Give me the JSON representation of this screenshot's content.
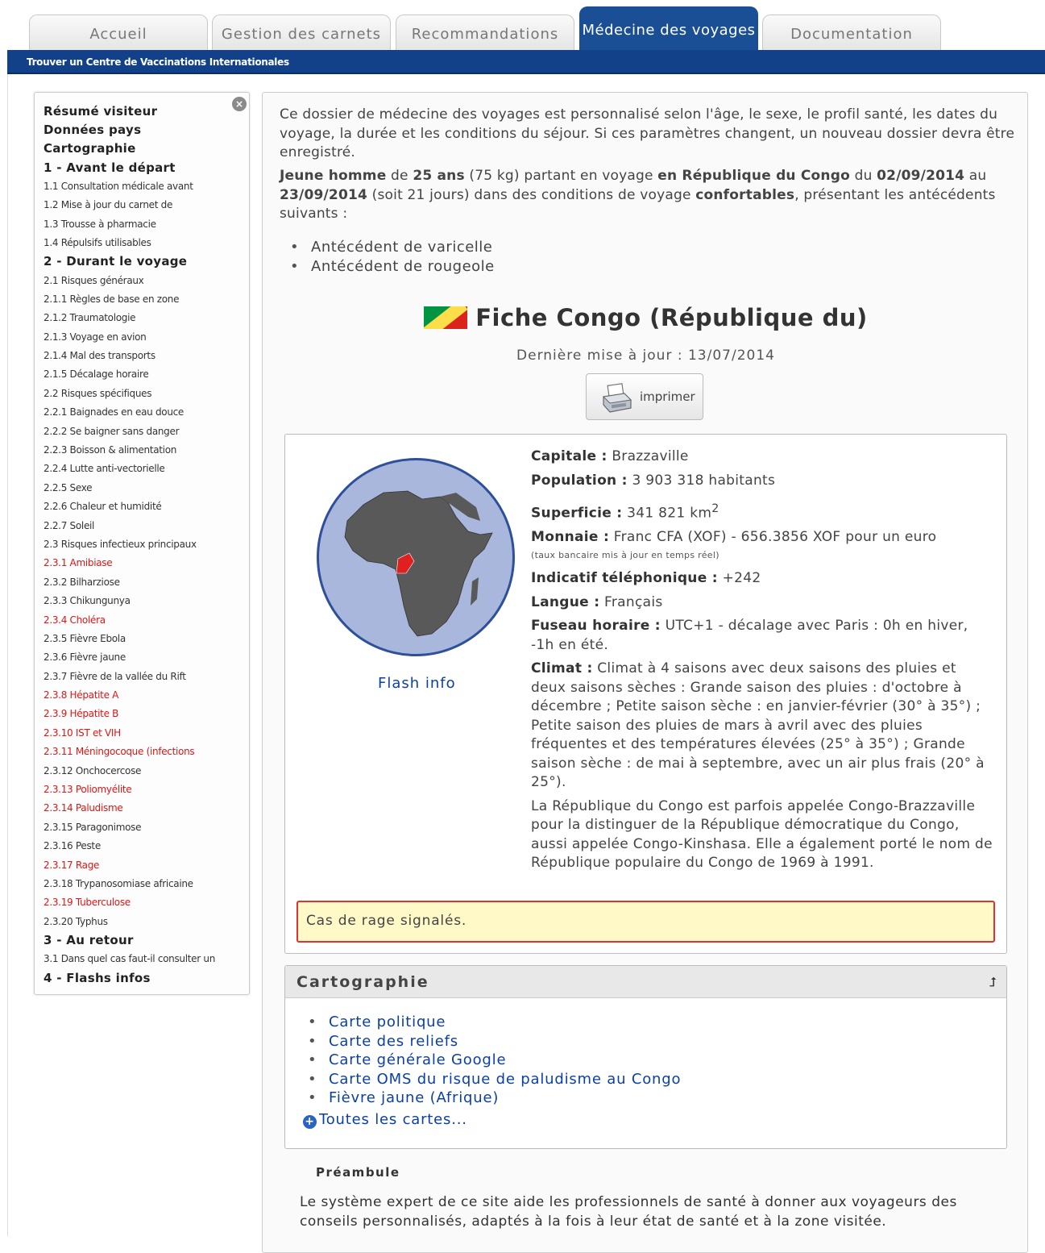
{
  "tabs": [
    {
      "label": "Accueil"
    },
    {
      "label": "Gestion des carnets"
    },
    {
      "label": "Recommandations"
    },
    {
      "label": "Médecine des voyages"
    },
    {
      "label": "Documentation"
    }
  ],
  "bluebar": {
    "link": "Trouver un Centre de Vaccinations Internationales"
  },
  "sidebar": {
    "close_icon": "×",
    "items": [
      {
        "label": "Résumé visiteur",
        "type": "h"
      },
      {
        "label": "Données pays",
        "type": "h"
      },
      {
        "label": "Cartographie",
        "type": "h"
      },
      {
        "label": "1 - Avant le départ",
        "type": "h"
      },
      {
        "label": "1.1 Consultation médicale avant",
        "type": "s"
      },
      {
        "label": "1.2 Mise à jour du carnet de",
        "type": "s"
      },
      {
        "label": "1.3 Trousse à pharmacie",
        "type": "s"
      },
      {
        "label": "1.4 Répulsifs utilisables",
        "type": "s"
      },
      {
        "label": "2 - Durant le voyage",
        "type": "h"
      },
      {
        "label": "2.1 Risques généraux",
        "type": "s"
      },
      {
        "label": "2.1.1 Règles de base en zone",
        "type": "s"
      },
      {
        "label": "2.1.2 Traumatologie",
        "type": "s"
      },
      {
        "label": "2.1.3 Voyage en avion",
        "type": "s"
      },
      {
        "label": "2.1.4 Mal des transports",
        "type": "s"
      },
      {
        "label": "2.1.5 Décalage horaire",
        "type": "s"
      },
      {
        "label": "2.2 Risques spécifiques",
        "type": "s"
      },
      {
        "label": "2.2.1 Baignades en eau douce",
        "type": "s"
      },
      {
        "label": "2.2.2 Se baigner sans danger",
        "type": "s"
      },
      {
        "label": "2.2.3 Boisson & alimentation",
        "type": "s"
      },
      {
        "label": "2.2.4 Lutte anti-vectorielle",
        "type": "s"
      },
      {
        "label": "2.2.5 Sexe",
        "type": "s"
      },
      {
        "label": "2.2.6 Chaleur et humidité",
        "type": "s"
      },
      {
        "label": "2.2.7 Soleil",
        "type": "s"
      },
      {
        "label": "2.3 Risques infectieux principaux",
        "type": "s"
      },
      {
        "label": "2.3.1 Amibiase",
        "type": "s red"
      },
      {
        "label": "2.3.2 Bilharziose",
        "type": "s"
      },
      {
        "label": "2.3.3 Chikungunya",
        "type": "s"
      },
      {
        "label": "2.3.4 Choléra",
        "type": "s red"
      },
      {
        "label": "2.3.5 Fièvre Ebola",
        "type": "s"
      },
      {
        "label": "2.3.6 Fièvre jaune",
        "type": "s"
      },
      {
        "label": "2.3.7 Fièvre de la vallée du Rift",
        "type": "s"
      },
      {
        "label": "2.3.8 Hépatite A",
        "type": "s red"
      },
      {
        "label": "2.3.9 Hépatite B",
        "type": "s red"
      },
      {
        "label": "2.3.10 IST et VIH",
        "type": "s red"
      },
      {
        "label": "2.3.11 Méningocoque (infections",
        "type": "s red"
      },
      {
        "label": "2.3.12 Onchocercose",
        "type": "s"
      },
      {
        "label": "2.3.13 Poliomyélite",
        "type": "s red"
      },
      {
        "label": "2.3.14 Paludisme",
        "type": "s red"
      },
      {
        "label": "2.3.15 Paragonimose",
        "type": "s"
      },
      {
        "label": "2.3.16 Peste",
        "type": "s"
      },
      {
        "label": "2.3.17 Rage",
        "type": "s red"
      },
      {
        "label": "2.3.18 Trypanosomiase africaine",
        "type": "s"
      },
      {
        "label": "2.3.19 Tuberculose",
        "type": "s red"
      },
      {
        "label": "2.3.20 Typhus",
        "type": "s"
      },
      {
        "label": "3 - Au retour",
        "type": "h"
      },
      {
        "label": "3.1 Dans quel cas faut-il consulter un",
        "type": "s"
      },
      {
        "label": "4 - Flashs infos",
        "type": "h"
      }
    ]
  },
  "intro": {
    "text": "Ce dossier de médecine des voyages est personnalisé selon l'âge, le sexe, le profil santé, les dates du voyage, la durée et les conditions du séjour. Si ces paramètres changent, un nouveau dossier devra être enregistré.",
    "profile": "Jeune homme",
    "de": " de ",
    "age": "25 ans",
    "weight": " (75 kg) partant en voyage ",
    "country": "en République du Congo",
    "du": " du ",
    "date_from": "02/09/2014",
    "au": " au ",
    "date_to": "23/09/2014",
    "duration": " (soit 21 jours) dans des conditions de voyage ",
    "conditions": "confortables",
    "tail": ", présentant les antécédents suivants :"
  },
  "antecedents": [
    "Antécédent de varicelle",
    "Antécédent de rougeole"
  ],
  "fiche": {
    "title": "Fiche Congo (République du)",
    "maj": "Dernière mise à jour : 13/07/2014",
    "print_label": "imprimer"
  },
  "infobox": {
    "flash_info": "Flash info",
    "capitale_k": "Capitale :",
    "capitale_v": " Brazzaville",
    "population_k": "Population :",
    "population_v": " 3 903 318 habitants",
    "superficie_k": "Superficie :",
    "superficie_v": " 341 821 km",
    "superficie_sup": "2",
    "monnaie_k": "Monnaie :",
    "monnaie_v": " Franc CFA (XOF) - 656.3856 XOF pour un euro",
    "monnaie_note": "(taux bancaire mis à jour en temps réel)",
    "indicatif_k": "Indicatif téléphonique :",
    "indicatif_v": " +242",
    "langue_k": "Langue :",
    "langue_v": " Français",
    "fuseau_k": "Fuseau horaire :",
    "fuseau_v": " UTC+1  - décalage avec Paris : 0h en hiver, -1h en été.",
    "climat_k": "Climat :",
    "climat_v": " Climat à 4 saisons avec deux saisons des pluies et deux saisons sèches : Grande saison des pluies : d'octobre à décembre ; Petite saison sèche : en janvier-février (30° à 35°) ; Petite saison des pluies de mars à avril avec des pluies fréquentes et des températures élevées (25° à 35°) ; Grande saison sèche : de mai à septembre, avec un air plus frais (20° à 25°).",
    "description": "La République du Congo est parfois appelée Congo-Brazzaville pour la distinguer de la République démocratique du Congo, aussi appelée Congo-Kinshasa. Elle a également porté le nom de République populaire du Congo de 1969 à 1991.",
    "alert": "Cas de rage signalés."
  },
  "cartographie": {
    "title": "Cartographie",
    "links": [
      "Carte politique",
      "Carte des reliefs",
      "Carte générale Google",
      "Carte OMS du risque de paludisme au Congo",
      "Fièvre jaune (Afrique)"
    ],
    "all_maps": "Toutes les cartes..."
  },
  "preambule": {
    "title": "Préambule",
    "text": "Le système expert de ce site aide les professionnels de santé à donner aux voyageurs des conseils personnalisés, adaptés à la fois à leur état de santé et à la zone visitée."
  },
  "colors": {
    "accent": "#1a4f96",
    "risk_red": "#e01515",
    "link": "#0b3fa8",
    "alert_bg": "#fff9c8"
  }
}
